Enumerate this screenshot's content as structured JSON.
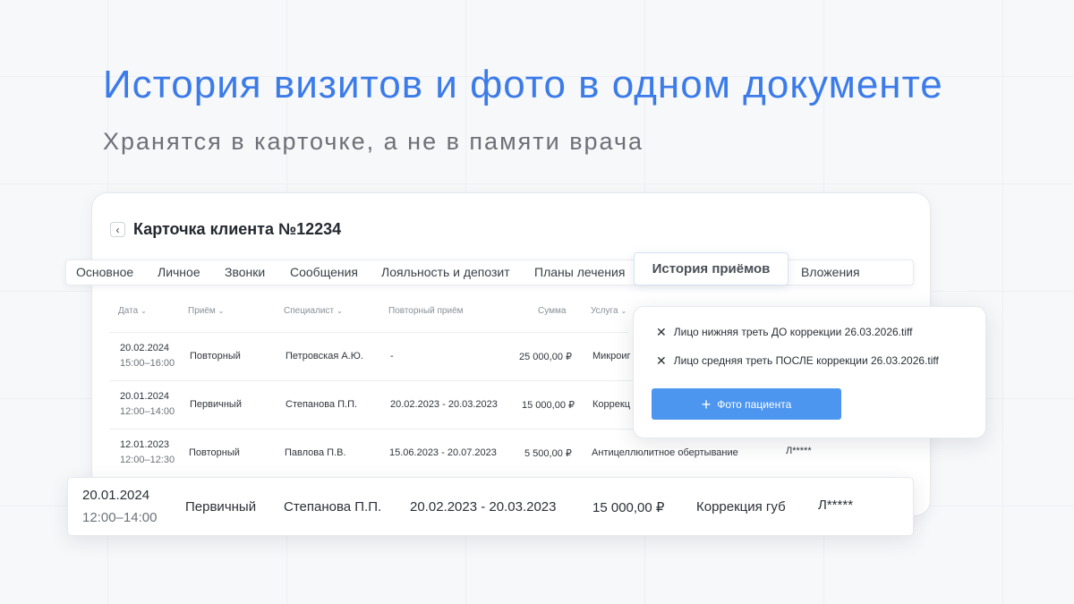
{
  "headline": "История визитов и фото в одном документе",
  "subline": "Хранятся в карточке, а не в памяти врача",
  "card": {
    "title": "Карточка клиента №12234",
    "back_icon": "‹"
  },
  "tabs": [
    "Основное",
    "Личное",
    "Звонки",
    "Сообщения",
    "Лояльность и депозит",
    "Планы лечения",
    "История приёмов",
    "Вложения"
  ],
  "table": {
    "headers": {
      "date": "Дата",
      "visit": "Приём",
      "specialist": "Специалист",
      "repeat": "Повторный приём",
      "sum": "Сумма",
      "service": "Услуга"
    },
    "rows": [
      {
        "date": "20.02.2024",
        "time": "15:00–16:00",
        "visit": "Повторный",
        "specialist": "Петровская А.Ю.",
        "repeat": "-",
        "sum": "25 000,00 ₽",
        "service": "Микроиг",
        "extra": ""
      },
      {
        "date": "20.01.2024",
        "time": "12:00–14:00",
        "visit": "Первичный",
        "specialist": "Степанова П.П.",
        "repeat": "20.02.2023 - 20.03.2023",
        "sum": "15 000,00 ₽",
        "service": "Коррекц",
        "extra": ""
      },
      {
        "date": "12.01.2023",
        "time": "12:00–12:30",
        "visit": "Повторный",
        "specialist": "Павлова П.В.",
        "repeat": "15.06.2023 - 20.07.2023",
        "sum": "5 500,00 ₽",
        "service": "Антицеллюлитное обертывание",
        "extra": "Л*****"
      }
    ]
  },
  "popup": {
    "files": [
      "Лицо нижняя треть ДО коррекции 26.03.2026.tiff",
      "Лицо средняя треть ПОСЛЕ коррекции 26.03.2026.tiff"
    ],
    "button_label": "Фото пациента"
  },
  "highlight": {
    "date": "20.01.2024",
    "time": "12:00–14:00",
    "visit": "Первичный",
    "specialist": "Степанова П.П.",
    "repeat": "20.02.2023 - 20.03.2023",
    "sum": "15 000,00 ₽",
    "service": "Коррекция губ",
    "extra": "Л*****"
  },
  "colors": {
    "headline": "#3b7bea",
    "button": "#4d96f0"
  }
}
